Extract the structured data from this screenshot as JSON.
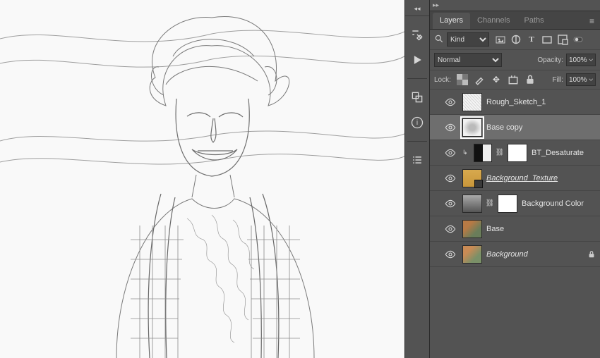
{
  "tabs": {
    "layers": "Layers",
    "channels": "Channels",
    "paths": "Paths"
  },
  "filter": {
    "kind": "Kind"
  },
  "blend": {
    "mode": "Normal",
    "opacity_label": "Opacity:",
    "opacity_value": "100%"
  },
  "lock": {
    "label": "Lock:",
    "fill_label": "Fill:",
    "fill_value": "100%"
  },
  "layers": [
    {
      "name": "Rough_Sketch_1"
    },
    {
      "name": "Base copy"
    },
    {
      "name": "BT_Desaturate"
    },
    {
      "name": "Background_Texture "
    },
    {
      "name": "Background Color"
    },
    {
      "name": "Base"
    },
    {
      "name": "Background"
    }
  ]
}
